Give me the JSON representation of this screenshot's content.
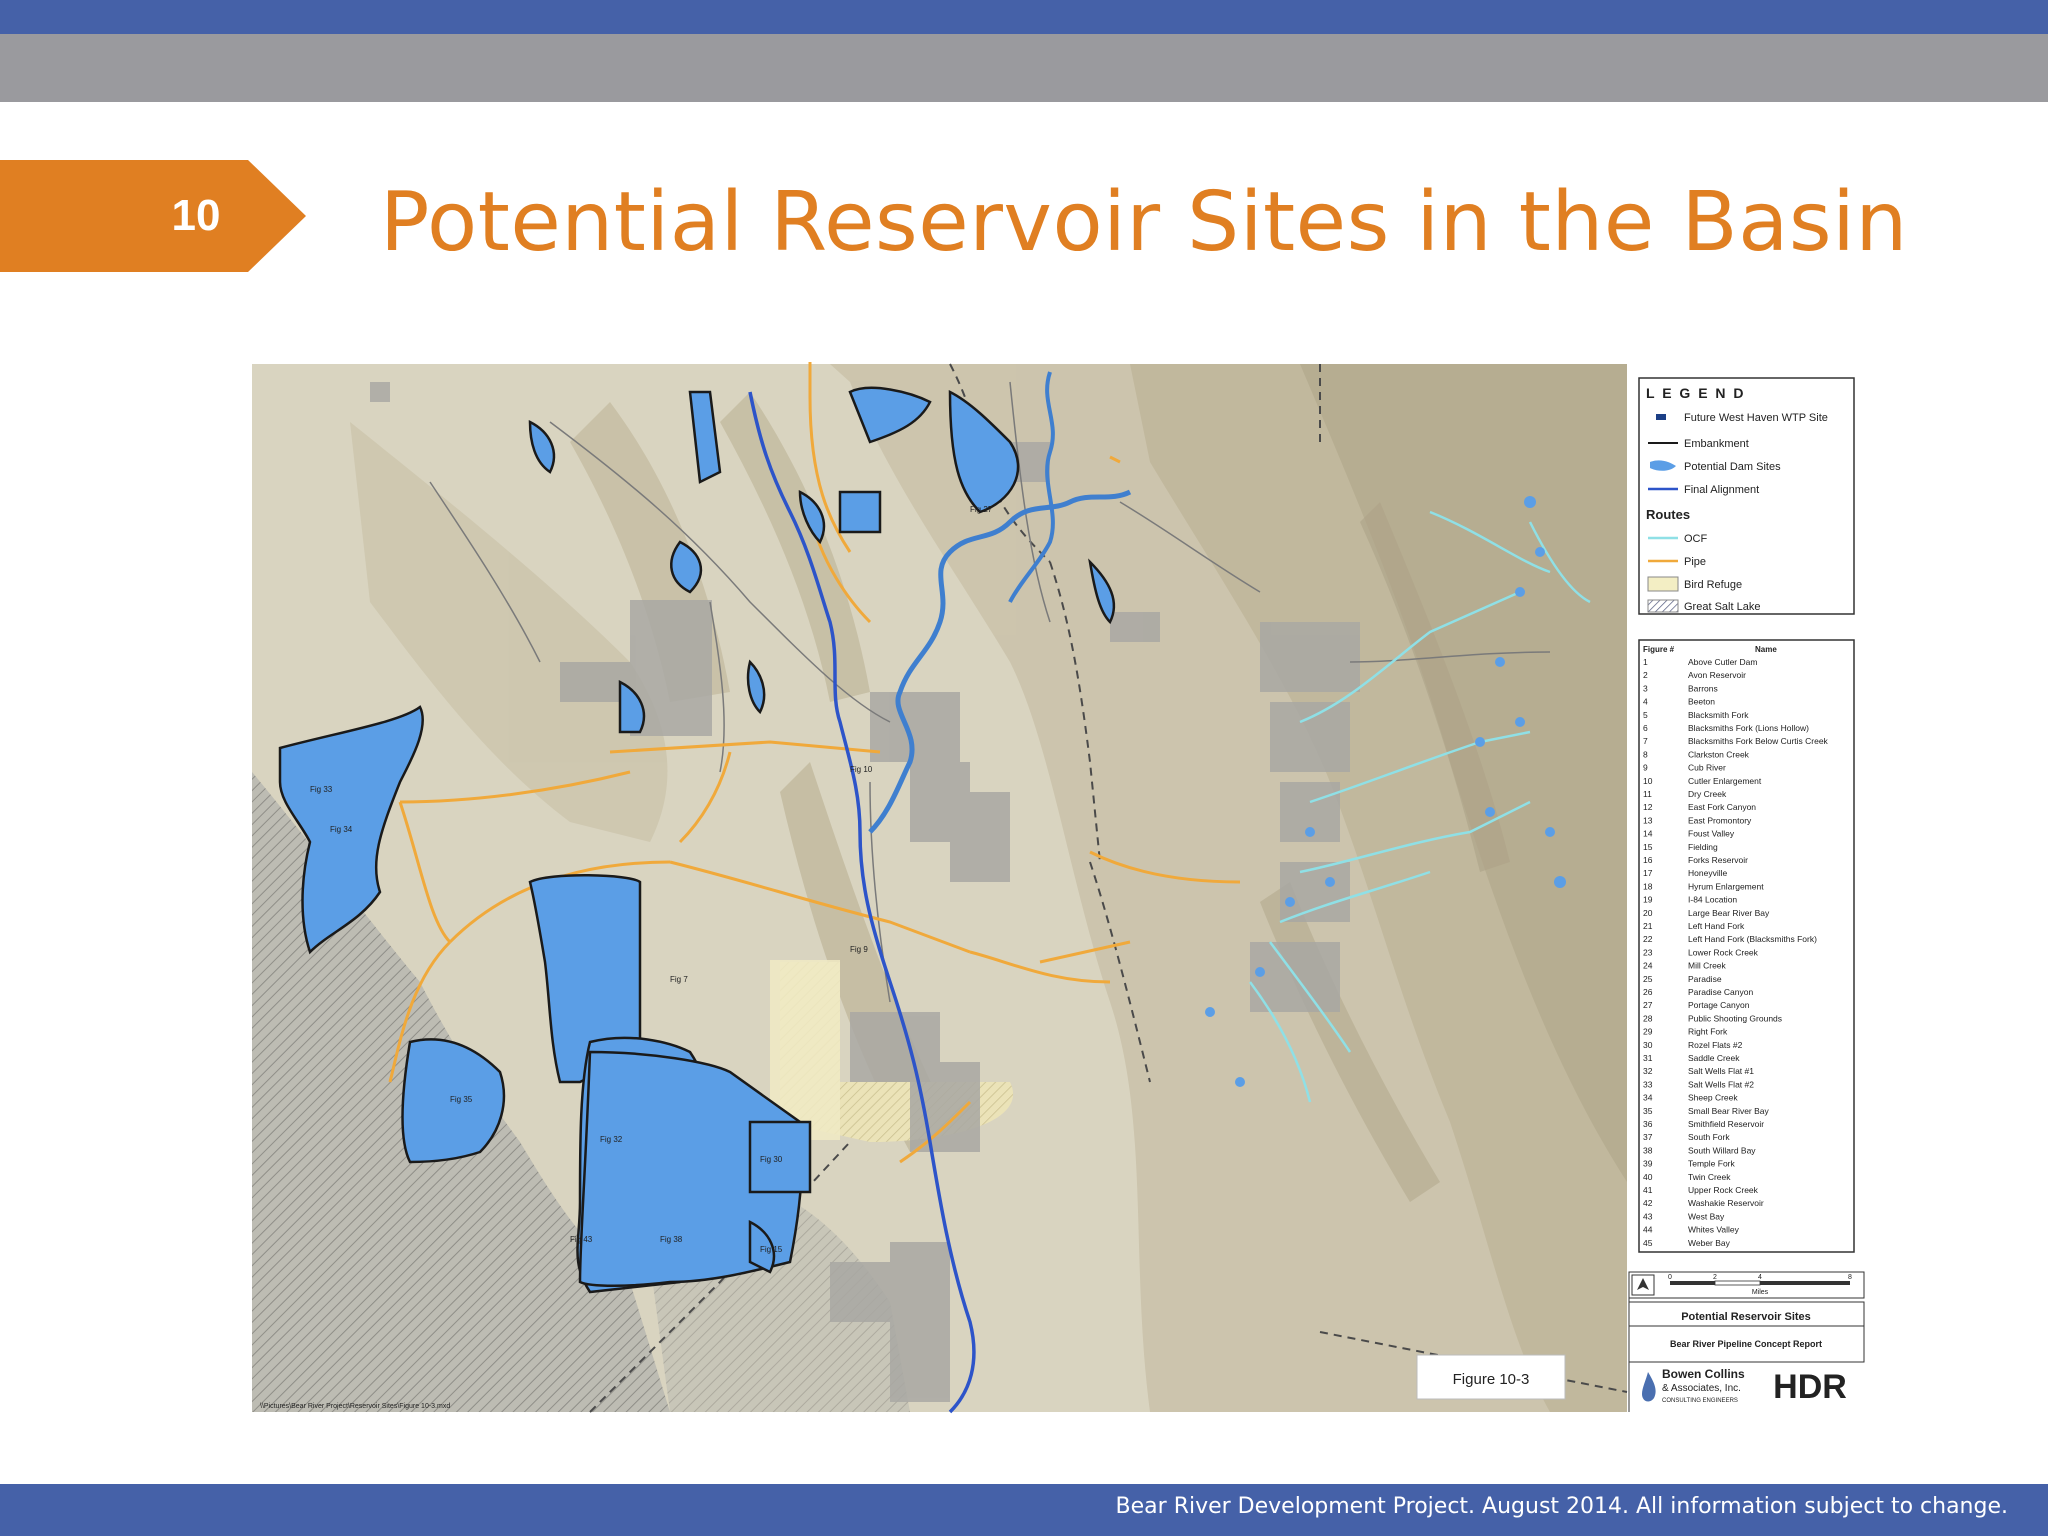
{
  "slide": {
    "number": "10",
    "title": "Potential Reservoir Sites in the Basin",
    "footer": "Bear River Development Project. August 2014. All information subject to change."
  },
  "map": {
    "legend": {
      "heading": "L E G E N D",
      "items": [
        {
          "label": "Future West Haven WTP Site",
          "color": "#1c3f86"
        },
        {
          "label": "Embankment",
          "color": "#1a1a1a"
        },
        {
          "label": "Potential Dam Sites",
          "color": "#5b9ee6"
        },
        {
          "label": "Final Alignment",
          "color": "#2d54c9"
        }
      ],
      "routes_heading": "Routes",
      "routes": [
        {
          "label": "OCF",
          "color": "#8fe0e6"
        },
        {
          "label": "Pipe",
          "color": "#f0a93b"
        },
        {
          "label": "Bird Refuge",
          "color": "#f3eec4"
        },
        {
          "label": "Great Salt Lake",
          "color": "#7a84a8"
        }
      ]
    },
    "figure_table": {
      "col_figure": "Figure #",
      "col_name": "Name",
      "rows": [
        [
          "1",
          "Above Cutler Dam"
        ],
        [
          "2",
          "Avon Reservoir"
        ],
        [
          "3",
          "Barrons"
        ],
        [
          "4",
          "Beeton"
        ],
        [
          "5",
          "Blacksmith Fork"
        ],
        [
          "6",
          "Blacksmiths Fork (Lions Hollow)"
        ],
        [
          "7",
          "Blacksmiths Fork Below Curtis Creek"
        ],
        [
          "8",
          "Clarkston Creek"
        ],
        [
          "9",
          "Cub River"
        ],
        [
          "10",
          "Cutler Enlargement"
        ],
        [
          "11",
          "Dry Creek"
        ],
        [
          "12",
          "East Fork Canyon"
        ],
        [
          "13",
          "East Promontory"
        ],
        [
          "14",
          "Foust Valley"
        ],
        [
          "15",
          "Fielding"
        ],
        [
          "16",
          "Forks Reservoir"
        ],
        [
          "17",
          "Honeyville"
        ],
        [
          "18",
          "Hyrum Enlargement"
        ],
        [
          "19",
          "I-84 Location"
        ],
        [
          "20",
          "Large Bear River Bay"
        ],
        [
          "21",
          "Left Hand Fork"
        ],
        [
          "22",
          "Left Hand Fork (Blacksmiths Fork)"
        ],
        [
          "23",
          "Lower Rock Creek"
        ],
        [
          "24",
          "Mill Creek"
        ],
        [
          "25",
          "Paradise"
        ],
        [
          "26",
          "Paradise Canyon"
        ],
        [
          "27",
          "Portage Canyon"
        ],
        [
          "28",
          "Public Shooting Grounds"
        ],
        [
          "29",
          "Right Fork"
        ],
        [
          "30",
          "Rozel Flats #2"
        ],
        [
          "31",
          "Saddle Creek"
        ],
        [
          "32",
          "Salt Wells Flat #1"
        ],
        [
          "33",
          "Salt Wells Flat #2"
        ],
        [
          "34",
          "Sheep Creek"
        ],
        [
          "35",
          "Small Bear River Bay"
        ],
        [
          "36",
          "Smithfield Reservoir"
        ],
        [
          "37",
          "South Fork"
        ],
        [
          "38",
          "South Willard Bay"
        ],
        [
          "39",
          "Temple Fork"
        ],
        [
          "40",
          "Twin Creek"
        ],
        [
          "41",
          "Upper Rock Creek"
        ],
        [
          "42",
          "Washakie Reservoir"
        ],
        [
          "43",
          "West Bay"
        ],
        [
          "44",
          "Whites Valley"
        ],
        [
          "45",
          "Weber Bay"
        ]
      ]
    },
    "scale_label": "Miles",
    "scale_ticks": [
      "0",
      "2",
      "4",
      "8"
    ],
    "title_block": {
      "title": "Potential Reservoir Sites",
      "subtitle": "Bear River Pipeline Concept Report"
    },
    "company": {
      "name_line1": "Bowen Collins",
      "name_line2": "& Associates, Inc.",
      "tagline": "CONSULTING ENGINEERS",
      "partner": "HDR"
    },
    "figure_label": "Figure 10-3"
  }
}
